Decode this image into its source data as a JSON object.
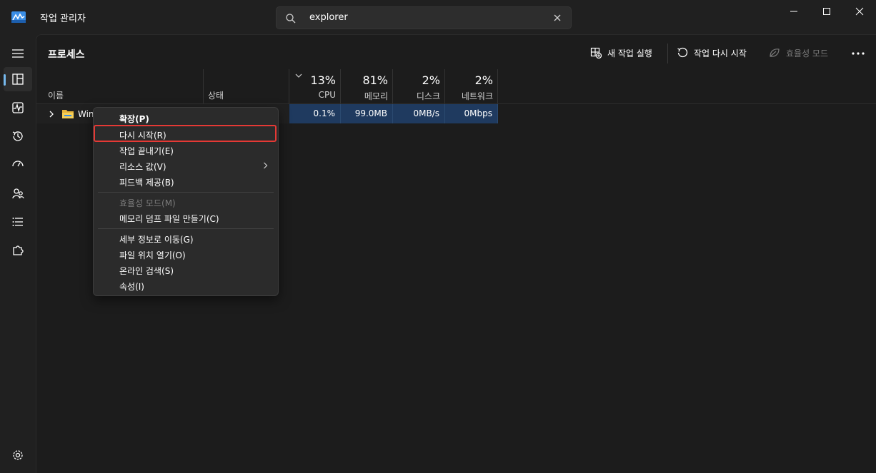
{
  "app": {
    "title": "작업 관리자"
  },
  "search": {
    "value": "explorer"
  },
  "page": {
    "title": "프로세스"
  },
  "toolbar": {
    "new_task": "새 작업 실행",
    "restart": "작업 다시 시작",
    "efficiency": "효율성 모드"
  },
  "columns": {
    "name": "이름",
    "status": "상태",
    "cpu": {
      "pct": "13%",
      "label": "CPU"
    },
    "memory": {
      "pct": "81%",
      "label": "메모리"
    },
    "disk": {
      "pct": "2%",
      "label": "디스크"
    },
    "network": {
      "pct": "2%",
      "label": "네트워크"
    }
  },
  "rows": [
    {
      "name": "Win",
      "cpu": "0.1%",
      "memory": "99.0MB",
      "disk": "0MB/s",
      "network": "0Mbps"
    }
  ],
  "context_menu": {
    "items": [
      {
        "label": "확장(P)"
      },
      {
        "label": "다시 시작(R)"
      },
      {
        "label": "작업 끝내기(E)"
      },
      {
        "label": "리소스 값(V)"
      },
      {
        "label": "피드백 제공(B)"
      },
      {
        "label": "효율성 모드(M)"
      },
      {
        "label": "메모리 덤프 파일 만들기(C)"
      },
      {
        "label": "세부 정보로 이동(G)"
      },
      {
        "label": "파일 위치 열기(O)"
      },
      {
        "label": "온라인 검색(S)"
      },
      {
        "label": "속성(I)"
      }
    ]
  },
  "colors": {
    "accent": "#76b9ed",
    "highlight": "#e53935",
    "selected_row": "#1f3a5f"
  }
}
